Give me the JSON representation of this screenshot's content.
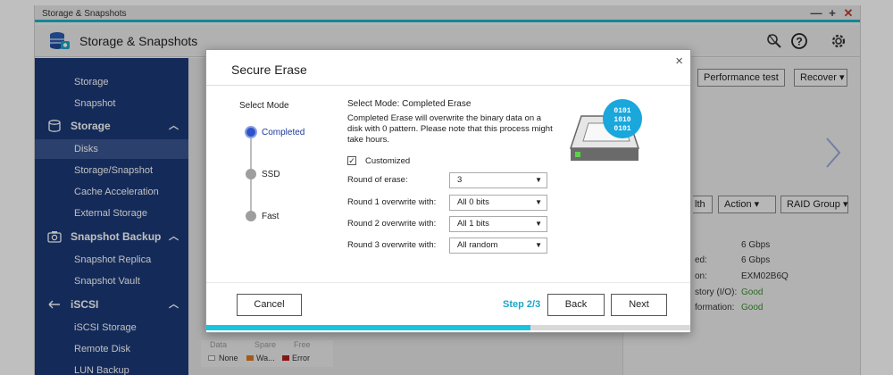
{
  "window": {
    "title": "Storage & Snapshots",
    "controls": [
      "—",
      "+",
      "✕"
    ]
  },
  "app": {
    "title": "Storage & Snapshots",
    "header_icons": [
      "wrench-search-icon",
      "help-icon",
      "gear-icon"
    ]
  },
  "sidebar": {
    "top_items": [
      "Storage",
      "Snapshot"
    ],
    "groups": [
      {
        "label": "Storage",
        "icon": "database-icon",
        "expanded": true,
        "items": [
          "Disks",
          "Storage/Snapshot",
          "Cache Acceleration",
          "External Storage"
        ],
        "active": "Disks"
      },
      {
        "label": "Snapshot Backup",
        "icon": "snapshot-backup-icon",
        "expanded": true,
        "items": [
          "Snapshot Replica",
          "Snapshot Vault"
        ]
      },
      {
        "label": "iSCSI",
        "icon": "iscsi-icon",
        "expanded": true,
        "items": [
          "iSCSI Storage",
          "Remote Disk",
          "LUN Backup"
        ]
      }
    ]
  },
  "background": {
    "top_buttons": [
      "Performance test",
      "Recover"
    ],
    "action_buttons": [
      "lth",
      "Action",
      "RAID Group"
    ],
    "info_rows": [
      {
        "label": "",
        "value": "6 Gbps"
      },
      {
        "label": "ed:",
        "value": "6 Gbps"
      },
      {
        "label": "on:",
        "value": "EXM02B6Q"
      },
      {
        "label": "story (I/O):",
        "value": "Good"
      },
      {
        "label": "formation:",
        "value": "Good"
      }
    ],
    "legend_top": [
      "Data",
      "Spare",
      "Free"
    ],
    "legend": [
      {
        "label": "None",
        "color": "#ffffff"
      },
      {
        "label": "Wa...",
        "color": "#d97a1e"
      },
      {
        "label": "Error",
        "color": "#b01e1e"
      }
    ]
  },
  "dialog": {
    "title": "Secure Erase",
    "close": "×",
    "steps_title": "Select Mode",
    "steps": [
      {
        "label": "Completed",
        "selected": true
      },
      {
        "label": "SSD",
        "selected": false
      },
      {
        "label": "Fast",
        "selected": false
      }
    ],
    "mode_title": "Select Mode: Completed Erase",
    "mode_desc": "Completed Erase will overwrite the binary data on a disk with 0 pattern. Please note that this process might take hours.",
    "customized": {
      "label": "Customized",
      "checked": true,
      "mark": "☑"
    },
    "fields": [
      {
        "label": "Round of erase:",
        "value": "3"
      },
      {
        "label": "Round 1 overwrite with:",
        "value": "All 0 bits"
      },
      {
        "label": "Round 2 overwrite with:",
        "value": "All 1 bits"
      },
      {
        "label": "Round 3 overwrite with:",
        "value": "All random"
      }
    ],
    "illustration": {
      "bits": [
        "0101",
        "1010",
        "0101"
      ],
      "accent": "#19a7dc"
    },
    "buttons": {
      "cancel": "Cancel",
      "back": "Back",
      "next": "Next"
    },
    "step_indicator": "Step 2/3",
    "progress_fraction": 0.67
  },
  "colors": {
    "sidebar": "#1b3a78",
    "sidebar_active": "#3a5690",
    "accent": "#1aa6c7",
    "progress": "#19c4e0"
  }
}
